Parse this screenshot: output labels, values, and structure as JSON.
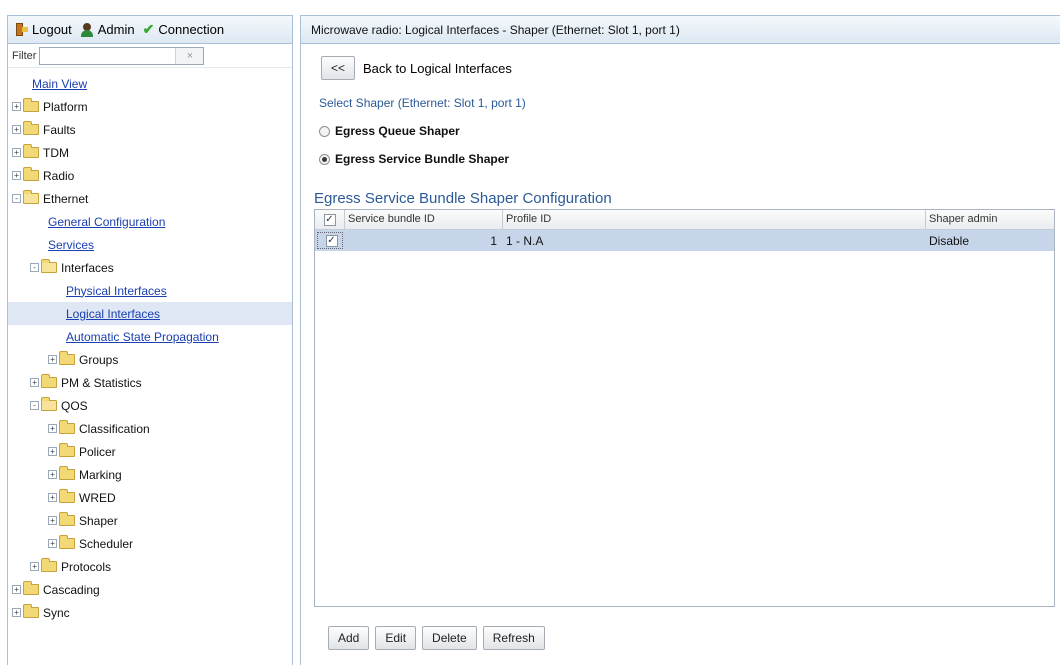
{
  "topbar": {
    "logout": "Logout",
    "admin": "Admin",
    "connection": "Connection"
  },
  "filter": {
    "label": "Filter",
    "value": "",
    "clear": "×"
  },
  "tree": [
    {
      "label": "Main View",
      "type": "link",
      "indent": 0
    },
    {
      "label": "Platform",
      "type": "folder",
      "indent": 0,
      "expander": "+"
    },
    {
      "label": "Faults",
      "type": "folder",
      "indent": 0,
      "expander": "+"
    },
    {
      "label": "TDM",
      "type": "folder",
      "indent": 0,
      "expander": "+"
    },
    {
      "label": "Radio",
      "type": "folder",
      "indent": 0,
      "expander": "+"
    },
    {
      "label": "Ethernet",
      "type": "folder",
      "indent": 0,
      "expander": "-",
      "open": true
    },
    {
      "label": "General Configuration",
      "type": "link",
      "indent": 1
    },
    {
      "label": "Services",
      "type": "link",
      "indent": 1
    },
    {
      "label": "Interfaces",
      "type": "folder",
      "indent": 1,
      "expander": "-",
      "open": true
    },
    {
      "label": "Physical Interfaces",
      "type": "link",
      "indent": 2
    },
    {
      "label": "Logical Interfaces",
      "type": "link",
      "indent": 2,
      "selected": true
    },
    {
      "label": "Automatic State Propagation",
      "type": "link",
      "indent": 2
    },
    {
      "label": "Groups",
      "type": "folder",
      "indent": 2,
      "expander": "+"
    },
    {
      "label": "PM & Statistics",
      "type": "folder",
      "indent": 1,
      "expander": "+"
    },
    {
      "label": "QOS",
      "type": "folder",
      "indent": 1,
      "expander": "-",
      "open": true
    },
    {
      "label": "Classification",
      "type": "folder",
      "indent": 2,
      "expander": "+"
    },
    {
      "label": "Policer",
      "type": "folder",
      "indent": 2,
      "expander": "+"
    },
    {
      "label": "Marking",
      "type": "folder",
      "indent": 2,
      "expander": "+"
    },
    {
      "label": "WRED",
      "type": "folder",
      "indent": 2,
      "expander": "+"
    },
    {
      "label": "Shaper",
      "type": "folder",
      "indent": 2,
      "expander": "+"
    },
    {
      "label": "Scheduler",
      "type": "folder",
      "indent": 2,
      "expander": "+"
    },
    {
      "label": "Protocols",
      "type": "folder",
      "indent": 1,
      "expander": "+"
    },
    {
      "label": "Cascading",
      "type": "folder",
      "indent": 0,
      "expander": "+"
    },
    {
      "label": "Sync",
      "type": "folder",
      "indent": 0,
      "expander": "+"
    }
  ],
  "main": {
    "title": "Microwave radio: Logical Interfaces - Shaper (Ethernet: Slot 1, port 1)",
    "back_button": "<<",
    "back_label": "Back to Logical Interfaces",
    "select_label": "Select Shaper (Ethernet: Slot 1, port 1)",
    "radio_queue": "Egress Queue Shaper",
    "radio_bundle": "Egress Service Bundle Shaper",
    "selected_radio": "bundle",
    "section_title": "Egress Service Bundle Shaper Configuration",
    "table": {
      "headers": [
        "Service bundle ID",
        "Profile ID",
        "Shaper admin"
      ],
      "rows": [
        {
          "checked": true,
          "service_bundle_id": "1",
          "profile_id": "1 - N.A",
          "shaper_admin": "Disable"
        }
      ]
    },
    "actions": {
      "add": "Add",
      "edit": "Edit",
      "delete": "Delete",
      "refresh": "Refresh"
    }
  },
  "colors": {
    "link": "#1a3fb0",
    "section_title": "#2b5a97",
    "selected_row": "#c6d5ea",
    "panel_border": "#a9bfd6"
  }
}
